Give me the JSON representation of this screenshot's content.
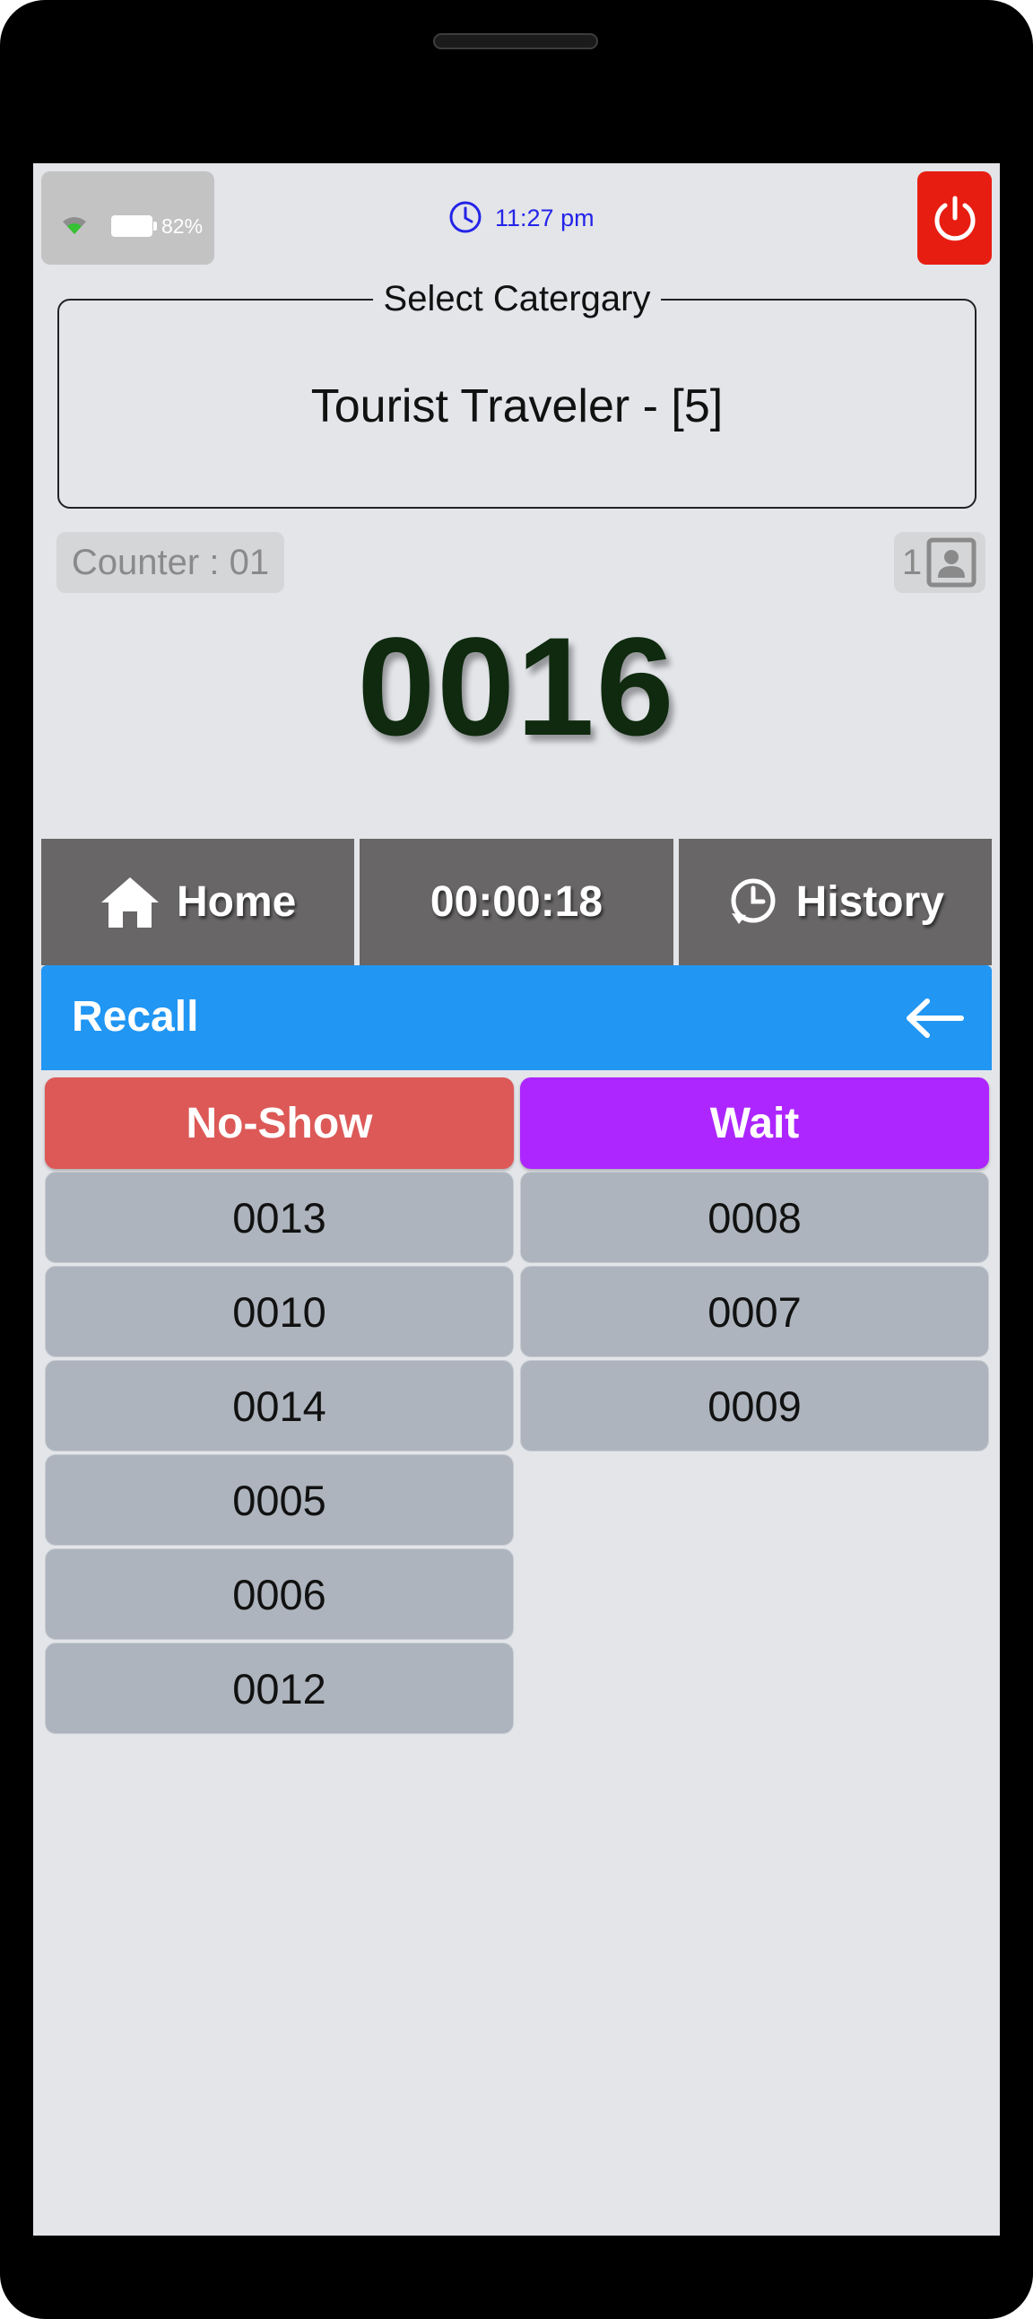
{
  "status": {
    "battery_percent": "82%",
    "time": "11:27 pm"
  },
  "category": {
    "legend": "Select Catergary",
    "value": "Tourist Traveler  - [5]"
  },
  "counter": {
    "label": "Counter : 01",
    "queue_count": "1"
  },
  "current_token": "0016",
  "actions": {
    "home_label": "Home",
    "timer": "00:00:18",
    "history_label": "History"
  },
  "recall": {
    "title": "Recall"
  },
  "no_show": {
    "label": "No-Show",
    "tokens": [
      "0013",
      "0010",
      "0014",
      "0005",
      "0006",
      "0012"
    ]
  },
  "wait": {
    "label": "Wait",
    "tokens": [
      "0008",
      "0007",
      "0009"
    ]
  },
  "colors": {
    "power": "#e81d12",
    "recall_header": "#2196f3",
    "no_show": "#dc5957",
    "wait": "#ad26ff",
    "token_bg": "#adb4bd"
  }
}
